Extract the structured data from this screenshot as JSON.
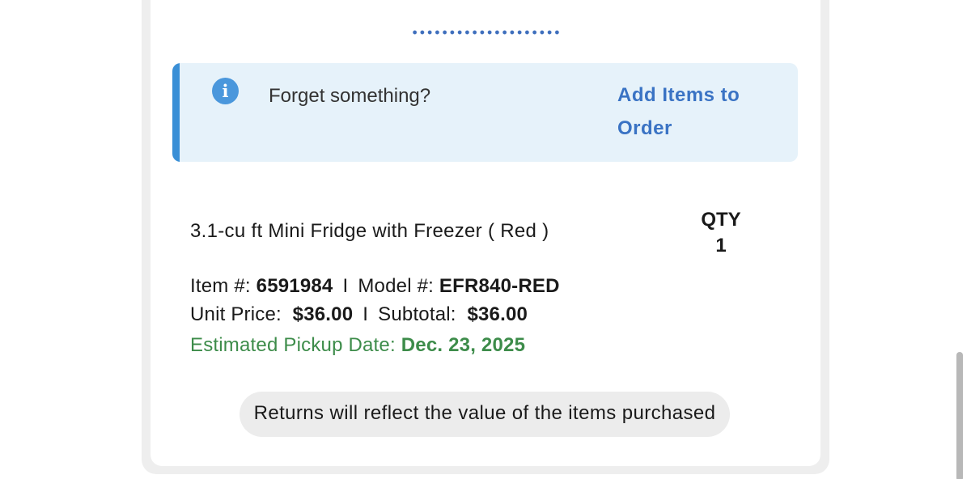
{
  "notice": {
    "icon": "info-icon",
    "icon_glyph": "i",
    "message": "Forget something?",
    "action_label": "Add Items to Order"
  },
  "product": {
    "name": "3.1-cu ft Mini Fridge with Freezer ( Red )",
    "qty_label": "QTY",
    "qty_value": "1",
    "item_label": "Item #:",
    "item_number": "6591984",
    "separator": "I",
    "model_label": "Model #:",
    "model_number": "EFR840-RED",
    "unit_price_label": "Unit Price:",
    "unit_price": "$36.00",
    "subtotal_label": "Subtotal:",
    "subtotal": "$36.00",
    "pickup_label": "Estimated Pickup Date:",
    "pickup_date": "Dec. 23, 2025"
  },
  "returns_note": "Returns will reflect the value of the items purchased",
  "colors": {
    "accent_blue": "#3a73c4",
    "notice_bg": "#e6f2fa",
    "notice_bar": "#3a8fd6",
    "pickup_green": "#3d8c4a"
  }
}
